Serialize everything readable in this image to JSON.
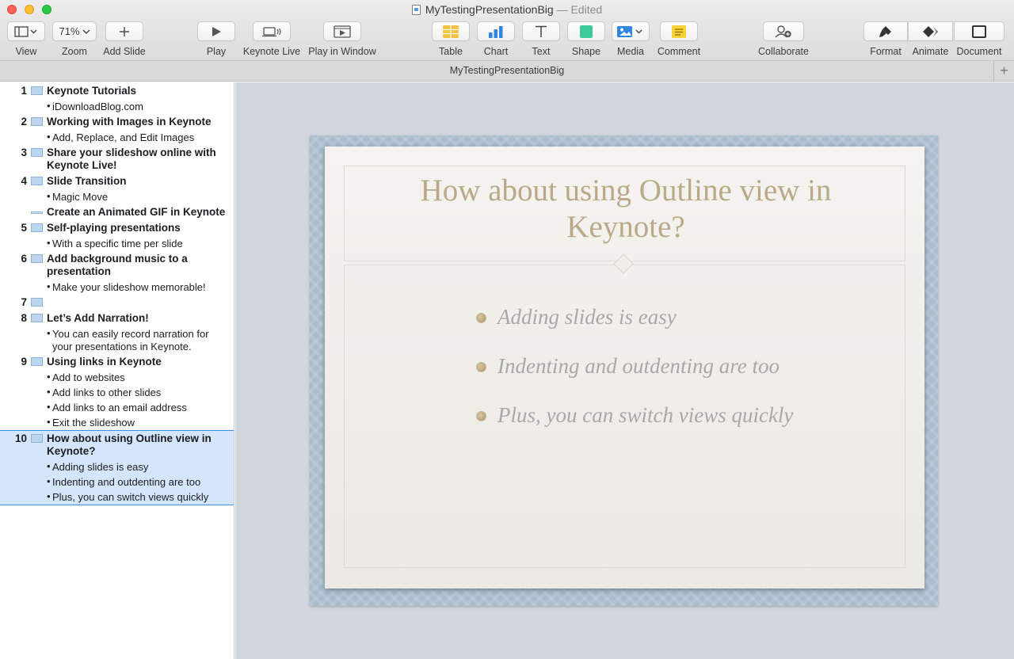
{
  "window": {
    "title": "MyTestingPresentationBig",
    "status": "— Edited"
  },
  "toolbar": {
    "view": {
      "label": "View",
      "icon": "view-icon"
    },
    "zoom": {
      "label": "Zoom",
      "value": "71%"
    },
    "add_slide": {
      "label": "Add Slide",
      "icon": "plus-icon"
    },
    "play": {
      "label": "Play",
      "icon": "play-icon"
    },
    "keynote_live": {
      "label": "Keynote Live",
      "icon": "keynote-live-icon"
    },
    "play_in_window": {
      "label": "Play in Window",
      "icon": "play-window-icon"
    },
    "table": {
      "label": "Table",
      "icon": "table-icon",
      "color": "#f5c242"
    },
    "chart": {
      "label": "Chart",
      "icon": "chart-icon",
      "color": "#2f86e0"
    },
    "text": {
      "label": "Text",
      "icon": "text-icon"
    },
    "shape": {
      "label": "Shape",
      "icon": "shape-icon",
      "color": "#3ccb9c"
    },
    "media": {
      "label": "Media",
      "icon": "media-icon",
      "color": "#2f86e0"
    },
    "comment": {
      "label": "Comment",
      "icon": "comment-icon",
      "color": "#f5d23a"
    },
    "collaborate": {
      "label": "Collaborate",
      "icon": "collaborate-icon"
    },
    "format": {
      "label": "Format",
      "icon": "format-brush-icon"
    },
    "animate": {
      "label": "Animate",
      "icon": "animate-icon"
    },
    "document": {
      "label": "Document",
      "icon": "document-icon"
    }
  },
  "tabbar": {
    "title": "MyTestingPresentationBig",
    "add": "+"
  },
  "outline": {
    "slides": [
      {
        "num": "1",
        "title": "Keynote Tutorials",
        "bullets": [
          "iDownloadBlog.com"
        ]
      },
      {
        "num": "2",
        "title": "Working with Images in Keynote",
        "bullets": [
          "Add, Replace, and Edit Images"
        ]
      },
      {
        "num": "3",
        "title": "Share your slideshow online with Keynote Live!",
        "bullets": []
      },
      {
        "num": "4",
        "title": "Slide Transition",
        "bullets": [
          "Magic Move"
        ]
      },
      {
        "num": "",
        "title": "Create an Animated GIF in Keynote",
        "bullets": []
      },
      {
        "num": "5",
        "title": "Self-playing presentations",
        "bullets": [
          "With a specific time per slide"
        ]
      },
      {
        "num": "6",
        "title": "Add background music to a presentation",
        "bullets": [
          "Make your slideshow memorable!"
        ]
      },
      {
        "num": "7",
        "title": "",
        "bullets": []
      },
      {
        "num": "8",
        "title": "Let’s Add Narration!",
        "bullets": [
          "You can easily record narration for your presentations in Keynote."
        ]
      },
      {
        "num": "9",
        "title": "Using links in Keynote",
        "bullets": [
          "Add  to websites",
          "Add links to other slides",
          "Add links to an email address",
          "Exit the slideshow"
        ]
      },
      {
        "num": "10",
        "title": "How about using Outline view in Keynote?",
        "bullets": [
          "Adding slides is easy",
          "Indenting and outdenting are too",
          "Plus, you can switch views quickly"
        ]
      }
    ]
  },
  "slide": {
    "title": "How about using Outline view in Keynote?",
    "bullets": [
      "Adding slides is easy",
      "Indenting and outdenting are too",
      "Plus, you can switch views quickly"
    ]
  }
}
